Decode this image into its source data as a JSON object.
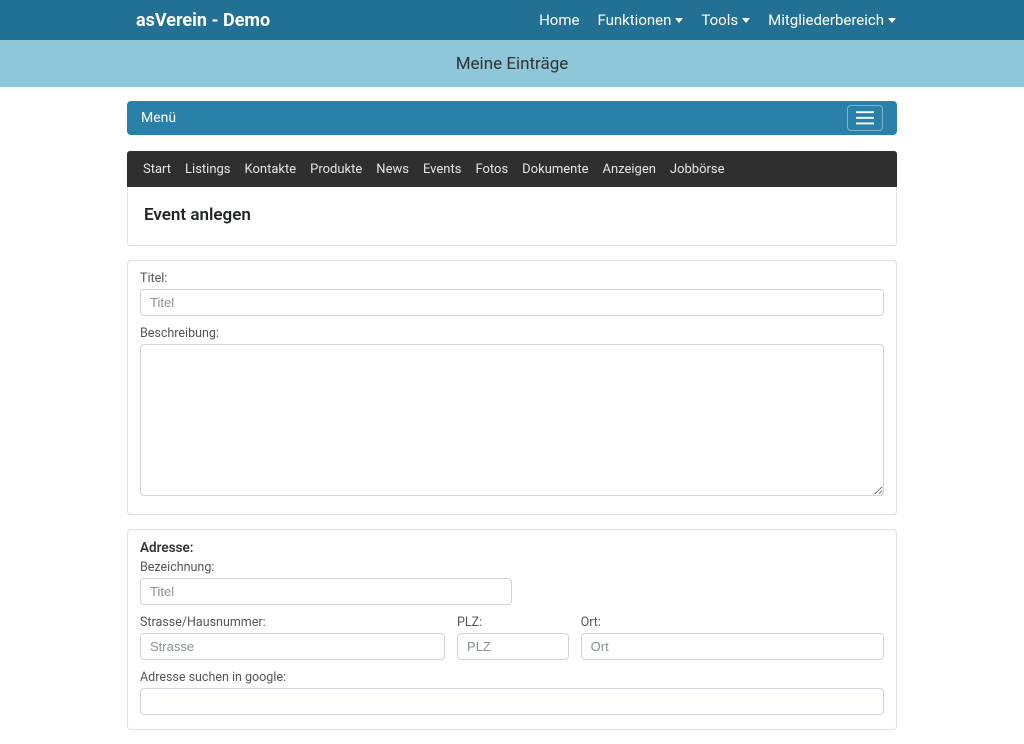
{
  "brand": "asVerein - Demo",
  "topnav": {
    "home": "Home",
    "funktionen": "Funktionen",
    "tools": "Tools",
    "mitglieder": "Mitgliederbereich"
  },
  "page_title": "Meine Einträge",
  "menu_label": "Menü",
  "subnav": {
    "start": "Start",
    "listings": "Listings",
    "kontakte": "Kontakte",
    "produkte": "Produkte",
    "news": "News",
    "events": "Events",
    "fotos": "Fotos",
    "dokumente": "Dokumente",
    "anzeigen": "Anzeigen",
    "jobboerse": "Jobbörse"
  },
  "form": {
    "heading": "Event anlegen",
    "titel_label": "Titel:",
    "titel_placeholder": "Titel",
    "beschreibung_label": "Beschreibung:",
    "adresse_heading": "Adresse:",
    "bezeichnung_label": "Bezeichnung:",
    "bezeichnung_placeholder": "Titel",
    "strasse_label": "Strasse/Hausnummer:",
    "strasse_placeholder": "Strasse",
    "plz_label": "PLZ:",
    "plz_placeholder": "PLZ",
    "ort_label": "Ort:",
    "ort_placeholder": "Ort",
    "adresse_suche_label": "Adresse suchen in google:"
  }
}
